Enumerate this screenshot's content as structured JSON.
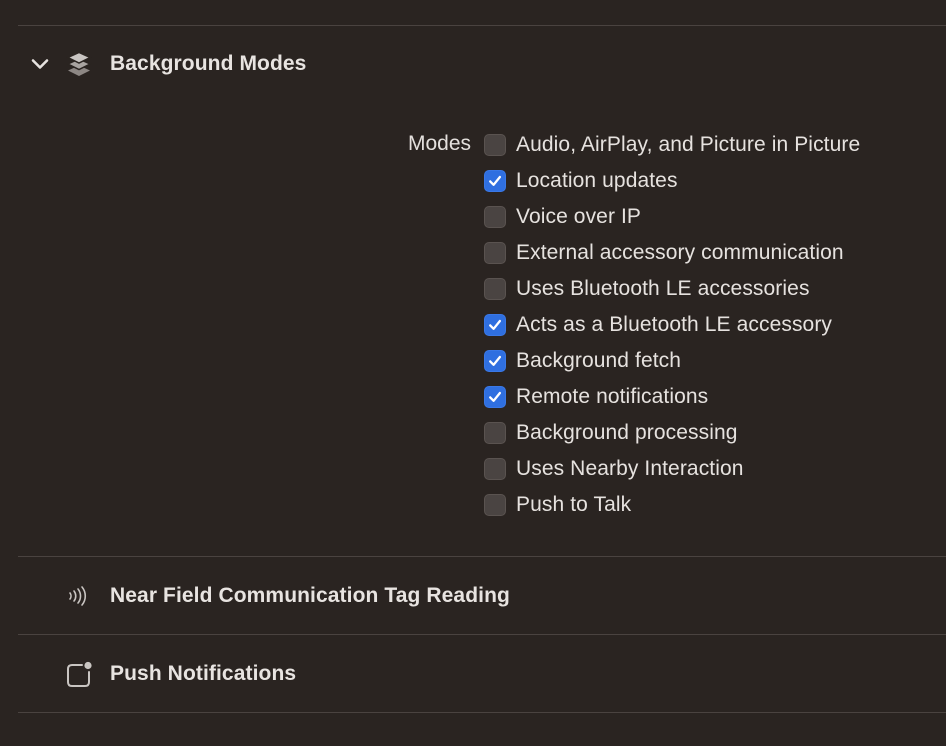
{
  "sections": {
    "background_modes": {
      "title": "Background Modes",
      "icon": "layers-icon",
      "expanded": true,
      "modes_label": "Modes",
      "modes": [
        {
          "label": "Audio, AirPlay, and Picture in Picture",
          "checked": false
        },
        {
          "label": "Location updates",
          "checked": true
        },
        {
          "label": "Voice over IP",
          "checked": false
        },
        {
          "label": "External accessory communication",
          "checked": false
        },
        {
          "label": "Uses Bluetooth LE accessories",
          "checked": false
        },
        {
          "label": "Acts as a Bluetooth LE accessory",
          "checked": true
        },
        {
          "label": "Background fetch",
          "checked": true
        },
        {
          "label": "Remote notifications",
          "checked": true
        },
        {
          "label": "Background processing",
          "checked": false
        },
        {
          "label": "Uses Nearby Interaction",
          "checked": false
        },
        {
          "label": "Push to Talk",
          "checked": false
        }
      ]
    },
    "nfc": {
      "title": "Near Field Communication Tag Reading",
      "icon": "nfc-waves-icon"
    },
    "push": {
      "title": "Push Notifications",
      "icon": "notification-badge-icon"
    }
  },
  "colors": {
    "background": "#2a2421",
    "divider": "#4a4340",
    "checkbox_checked": "#2f6fe0",
    "checkbox_unchecked": "#4a4442",
    "text": "#e6e2df"
  }
}
